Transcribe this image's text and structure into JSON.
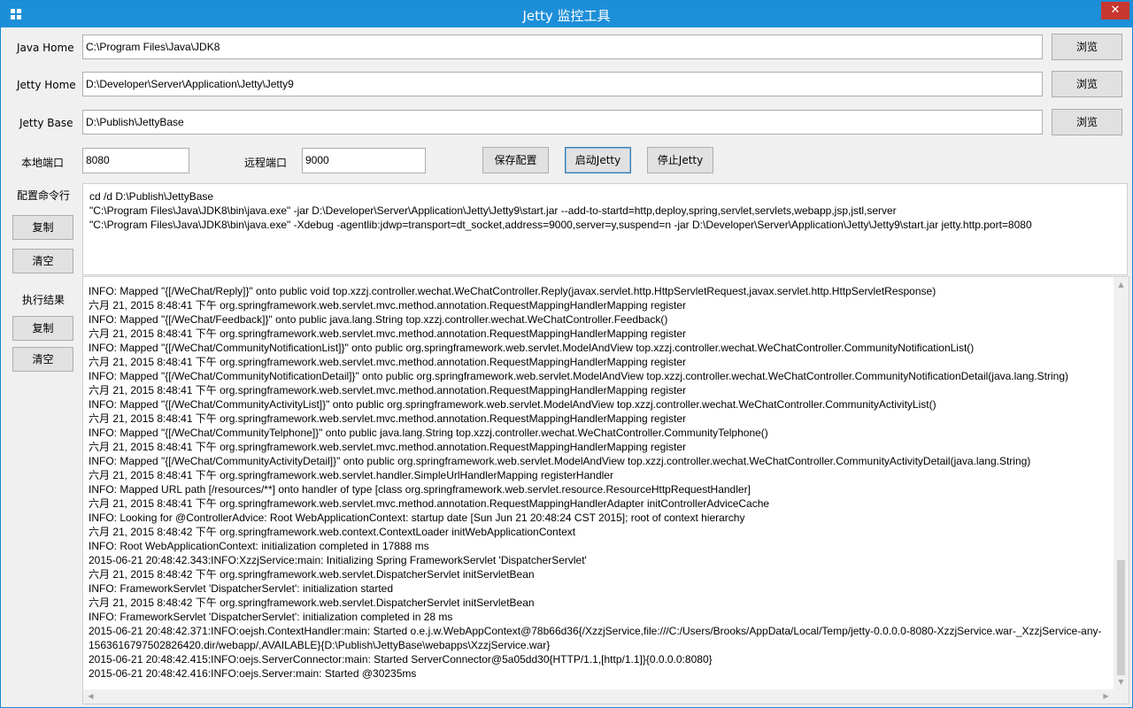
{
  "window": {
    "title": "Jetty 监控工具",
    "close_glyph": "✕",
    "icon": "app-grid-icon",
    "accent": "#1d8fd8",
    "close_color": "#c7372f"
  },
  "paths": {
    "java_home": {
      "label": "Java Home",
      "value": "C:\\Program Files\\Java\\JDK8",
      "browse": "浏览"
    },
    "jetty_home": {
      "label": "Jetty Home",
      "value": "D:\\Developer\\Server\\Application\\Jetty\\Jetty9",
      "browse": "浏览"
    },
    "jetty_base": {
      "label": "Jetty Base",
      "value": "D:\\Publish\\JettyBase",
      "browse": "浏览"
    }
  },
  "ports": {
    "local_label": "本地端口",
    "local_value": "8080",
    "remote_label": "远程端口",
    "remote_value": "9000"
  },
  "actions": {
    "save": "保存配置",
    "start": "启动Jetty",
    "stop": "停止Jetty"
  },
  "config_section": {
    "label": "配置命令行",
    "copy": "复制",
    "clear": "清空",
    "command_text": "cd /d D:\\Publish\\JettyBase\n\"C:\\Program Files\\Java\\JDK8\\bin\\java.exe\" -jar D:\\Developer\\Server\\Application\\Jetty\\Jetty9\\start.jar --add-to-startd=http,deploy,spring,servlet,servlets,webapp,jsp,jstl,server\n\"C:\\Program Files\\Java\\JDK8\\bin\\java.exe\" -Xdebug -agentlib:jdwp=transport=dt_socket,address=9000,server=y,suspend=n -jar D:\\Developer\\Server\\Application\\Jetty\\Jetty9\\start.jar jetty.http.port=8080"
  },
  "result_section": {
    "label": "执行结果",
    "copy": "复制",
    "clear": "清空"
  },
  "log_lines": [
    "INFO: Mapped \"{[/WeChat/Reply]}\" onto public void top.xzzj.controller.wechat.WeChatController.Reply(javax.servlet.http.HttpServletRequest,javax.servlet.http.HttpServletResponse)",
    "六月 21, 2015 8:48:41 下午 org.springframework.web.servlet.mvc.method.annotation.RequestMappingHandlerMapping register",
    "INFO: Mapped \"{[/WeChat/Feedback]}\" onto public java.lang.String top.xzzj.controller.wechat.WeChatController.Feedback()",
    "六月 21, 2015 8:48:41 下午 org.springframework.web.servlet.mvc.method.annotation.RequestMappingHandlerMapping register",
    "INFO: Mapped \"{[/WeChat/CommunityNotificationList]}\" onto public org.springframework.web.servlet.ModelAndView top.xzzj.controller.wechat.WeChatController.CommunityNotificationList()",
    "六月 21, 2015 8:48:41 下午 org.springframework.web.servlet.mvc.method.annotation.RequestMappingHandlerMapping register",
    "INFO: Mapped \"{[/WeChat/CommunityNotificationDetail]}\" onto public org.springframework.web.servlet.ModelAndView top.xzzj.controller.wechat.WeChatController.CommunityNotificationDetail(java.lang.String)",
    "六月 21, 2015 8:48:41 下午 org.springframework.web.servlet.mvc.method.annotation.RequestMappingHandlerMapping register",
    "INFO: Mapped \"{[/WeChat/CommunityActivityList]}\" onto public org.springframework.web.servlet.ModelAndView top.xzzj.controller.wechat.WeChatController.CommunityActivityList()",
    "六月 21, 2015 8:48:41 下午 org.springframework.web.servlet.mvc.method.annotation.RequestMappingHandlerMapping register",
    "INFO: Mapped \"{[/WeChat/CommunityTelphone]}\" onto public java.lang.String top.xzzj.controller.wechat.WeChatController.CommunityTelphone()",
    "六月 21, 2015 8:48:41 下午 org.springframework.web.servlet.mvc.method.annotation.RequestMappingHandlerMapping register",
    "INFO: Mapped \"{[/WeChat/CommunityActivityDetail]}\" onto public org.springframework.web.servlet.ModelAndView top.xzzj.controller.wechat.WeChatController.CommunityActivityDetail(java.lang.String)",
    "六月 21, 2015 8:48:41 下午 org.springframework.web.servlet.handler.SimpleUrlHandlerMapping registerHandler",
    "INFO: Mapped URL path [/resources/**] onto handler of type [class org.springframework.web.servlet.resource.ResourceHttpRequestHandler]",
    "六月 21, 2015 8:48:41 下午 org.springframework.web.servlet.mvc.method.annotation.RequestMappingHandlerAdapter initControllerAdviceCache",
    "INFO: Looking for @ControllerAdvice: Root WebApplicationContext: startup date [Sun Jun 21 20:48:24 CST 2015]; root of context hierarchy",
    "六月 21, 2015 8:48:42 下午 org.springframework.web.context.ContextLoader initWebApplicationContext",
    "INFO: Root WebApplicationContext: initialization completed in 17888 ms",
    "2015-06-21 20:48:42.343:INFO:XzzjService:main: Initializing Spring FrameworkServlet 'DispatcherServlet'",
    "六月 21, 2015 8:48:42 下午 org.springframework.web.servlet.DispatcherServlet initServletBean",
    "INFO: FrameworkServlet 'DispatcherServlet': initialization started",
    "六月 21, 2015 8:48:42 下午 org.springframework.web.servlet.DispatcherServlet initServletBean",
    "INFO: FrameworkServlet 'DispatcherServlet': initialization completed in 28 ms",
    "2015-06-21 20:48:42.371:INFO:oejsh.ContextHandler:main: Started o.e.j.w.WebAppContext@78b66d36{/XzzjService,file:///C:/Users/Brooks/AppData/Local/Temp/jetty-0.0.0.0-8080-XzzjService.war-_XzzjService-any-1563616797502826420.dir/webapp/,AVAILABLE}{D:\\Publish\\JettyBase\\webapps\\XzzjService.war}",
    "2015-06-21 20:48:42.415:INFO:oejs.ServerConnector:main: Started ServerConnector@5a05dd30{HTTP/1.1,[http/1.1]}{0.0.0.0:8080}",
    "2015-06-21 20:48:42.416:INFO:oejs.Server:main: Started @30235ms"
  ],
  "scroll": {
    "up_arrow": "▲",
    "down_arrow": "▼",
    "left_arrow": "◀",
    "right_arrow": "▶"
  }
}
